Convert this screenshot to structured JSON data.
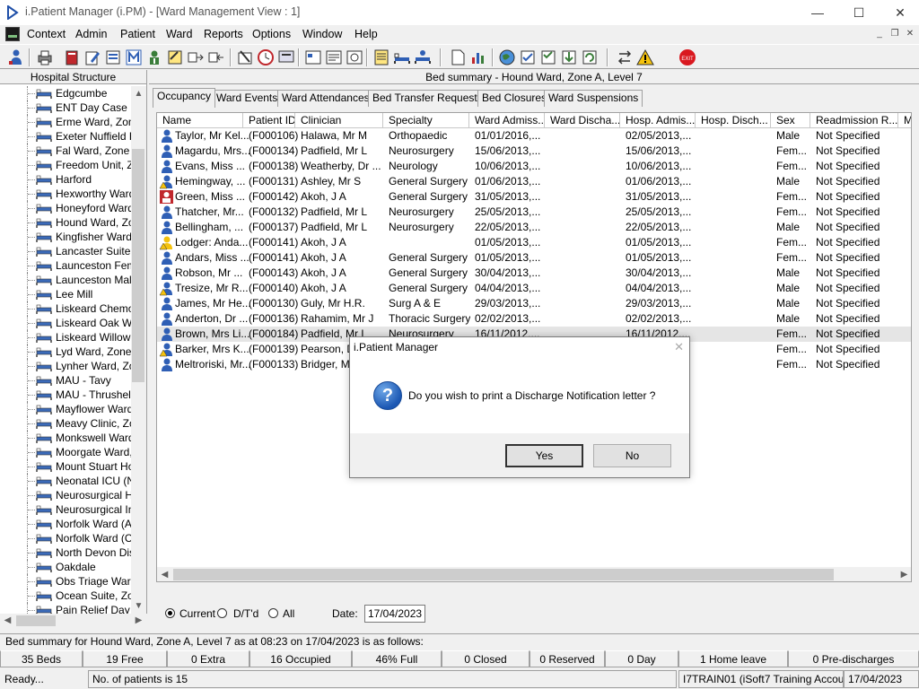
{
  "window": {
    "title": "i.Patient Manager (i.PM) - [Ward Management View : 1]",
    "minimize": "—",
    "maximize": "☐",
    "close": "✕"
  },
  "menu": {
    "items": [
      "Context",
      "Admin",
      "Patient",
      "Ward",
      "Reports",
      "Options",
      "Window",
      "Help"
    ],
    "mdi_min": "_",
    "mdi_restore": "❐",
    "mdi_close": "✕"
  },
  "left_panel": {
    "header": "Hospital Structure",
    "items": [
      "Edgcumbe",
      "ENT Day Case U",
      "Erme Ward, Zone",
      "Exeter Nuffield He",
      "Fal Ward, Zone E",
      "Freedom Unit, Zo",
      "Harford",
      "Hexworthy Ward,",
      "Honeyford Ward,",
      "Hound Ward, Zor",
      "Kingfisher Ward",
      "Lancaster Suite, Z",
      "Launceston Fema",
      "Launceston Male",
      "Lee Mill",
      "Liskeard Chemo D",
      "Liskeard Oak Wa",
      "Liskeard Willow V",
      "Lyd Ward, Zone I",
      "Lynher Ward, Zor",
      "MAU - Tavy",
      "MAU - Thrushel",
      "Mayflower Ward,",
      "Meavy Clinic, Zor",
      "Monkswell Ward,",
      "Moorgate Ward, Z",
      "Mount Stuart Hos",
      "Neonatal ICU (NN",
      "Neurosurgical Hig",
      "Neurosurgical Inte",
      "Norfolk Ward (Ad",
      "Norfolk Ward (Co",
      "North Devon Dist",
      "Oakdale",
      "Obs Triage Ward",
      "Ocean Suite, Zor",
      "Pain Relief Day C"
    ]
  },
  "main": {
    "bed_summary": "Bed summary - Hound Ward, Zone A, Level 7",
    "tabs": [
      "Occupancy",
      "Ward Events",
      "Ward Attendances",
      "Bed Transfer Requests",
      "Bed Closures",
      "Ward Suspensions"
    ],
    "columns": [
      "Name",
      "Patient ID",
      "Clinician",
      "Specialty",
      "Ward Admiss...",
      "Ward Discha...",
      "Hosp. Admis...",
      "Hosp. Disch...",
      "Sex",
      "Readmission R...",
      "Me"
    ],
    "rows": [
      {
        "icon": "patient-blue",
        "name": "Taylor, Mr Kel...",
        "id": "(F000106)",
        "clinician": "Halawa, Mr M",
        "specialty": "Orthopaedic",
        "ward_adm": "01/01/2016,...",
        "hosp_adm": "02/05/2013,...",
        "sex": "Male",
        "readm": "Not Specified"
      },
      {
        "icon": "patient-blue",
        "name": "Magardu, Mrs...",
        "id": "(F000134)",
        "clinician": "Padfield, Mr L",
        "specialty": "Neurosurgery",
        "ward_adm": "15/06/2013,...",
        "hosp_adm": "15/06/2013,...",
        "sex": "Fem...",
        "readm": "Not Specified"
      },
      {
        "icon": "patient-blue",
        "name": "Evans, Miss ...",
        "id": "(F000138)",
        "clinician": "Weatherby, Dr ...",
        "specialty": "Neurology",
        "ward_adm": "10/06/2013,...",
        "hosp_adm": "10/06/2013,...",
        "sex": "Fem...",
        "readm": "Not Specified"
      },
      {
        "icon": "patient-warning",
        "name": "Hemingway, ...",
        "id": "(F000131)",
        "clinician": "Ashley, Mr S",
        "specialty": "General Surgery",
        "ward_adm": "01/06/2013,...",
        "hosp_adm": "01/06/2013,...",
        "sex": "Male",
        "readm": "Not Specified"
      },
      {
        "icon": "patient-red",
        "name": "Green, Miss ...",
        "id": "(F000142)",
        "clinician": "Akoh, J A",
        "specialty": "General Surgery",
        "ward_adm": "31/05/2013,...",
        "hosp_adm": "31/05/2013,...",
        "sex": "Fem...",
        "readm": "Not Specified"
      },
      {
        "icon": "patient-blue",
        "name": "Thatcher, Mr...",
        "id": "(F000132)",
        "clinician": "Padfield, Mr L",
        "specialty": "Neurosurgery",
        "ward_adm": "25/05/2013,...",
        "hosp_adm": "25/05/2013,...",
        "sex": "Fem...",
        "readm": "Not Specified"
      },
      {
        "icon": "patient-blue",
        "name": "Bellingham, ...",
        "id": "(F000137)",
        "clinician": "Padfield, Mr L",
        "specialty": "Neurosurgery",
        "ward_adm": "22/05/2013,...",
        "hosp_adm": "22/05/2013,...",
        "sex": "Male",
        "readm": "Not Specified"
      },
      {
        "icon": "patient-yellow",
        "name": "Lodger: Anda...",
        "id": "(F000141)",
        "clinician": "Akoh, J A",
        "specialty": "",
        "ward_adm": "01/05/2013,...",
        "hosp_adm": "01/05/2013,...",
        "sex": "Fem...",
        "readm": "Not Specified"
      },
      {
        "icon": "patient-blue",
        "name": "Andars, Miss ...",
        "id": "(F000141)",
        "clinician": "Akoh, J A",
        "specialty": "General Surgery",
        "ward_adm": "01/05/2013,...",
        "hosp_adm": "01/05/2013,...",
        "sex": "Fem...",
        "readm": "Not Specified"
      },
      {
        "icon": "patient-blue",
        "name": "Robson, Mr ...",
        "id": "(F000143)",
        "clinician": "Akoh, J A",
        "specialty": "General Surgery",
        "ward_adm": "30/04/2013,...",
        "hosp_adm": "30/04/2013,...",
        "sex": "Male",
        "readm": "Not Specified"
      },
      {
        "icon": "patient-warning",
        "name": "Tresize, Mr R...",
        "id": "(F000140)",
        "clinician": "Akoh, J A",
        "specialty": "General Surgery",
        "ward_adm": "04/04/2013,...",
        "hosp_adm": "04/04/2013,...",
        "sex": "Male",
        "readm": "Not Specified"
      },
      {
        "icon": "patient-blue",
        "name": "James, Mr He...",
        "id": "(F000130)",
        "clinician": "Guly, Mr H.R.",
        "specialty": "Surg A & E",
        "ward_adm": "29/03/2013,...",
        "hosp_adm": "29/03/2013,...",
        "sex": "Male",
        "readm": "Not Specified"
      },
      {
        "icon": "patient-blue",
        "name": "Anderton, Dr ...",
        "id": "(F000136)",
        "clinician": "Rahamim, Mr J",
        "specialty": "Thoracic Surgery",
        "ward_adm": "02/02/2013,...",
        "hosp_adm": "02/02/2013,...",
        "sex": "Male",
        "readm": "Not Specified"
      },
      {
        "icon": "patient-blue",
        "name": "Brown, Mrs Li...",
        "id": "(F000184)",
        "clinician": "Padfield, Mr L",
        "specialty": "Neurosurgery",
        "ward_adm": "16/11/2012,...",
        "hosp_adm": "16/11/2012,...",
        "sex": "Fem...",
        "readm": "Not Specified"
      },
      {
        "icon": "patient-warning",
        "name": "Barker, Mrs K...",
        "id": "(F000139)",
        "clinician": "Pearson, D",
        "specialty": "",
        "ward_adm": "",
        "hosp_adm": "",
        "sex": "Fem...",
        "readm": "Not Specified"
      },
      {
        "icon": "patient-blue",
        "name": "Meltroriski, Mr...",
        "id": "(F000133)",
        "clinician": "Bridger, Mr",
        "specialty": "",
        "ward_adm": "",
        "hosp_adm": "",
        "sex": "Fem...",
        "readm": "Not Specified"
      }
    ],
    "filter": {
      "options": [
        "Current",
        "D/T'd",
        "All"
      ],
      "selected": "Current",
      "date_label": "Date:",
      "date_value": "17/04/2023"
    }
  },
  "summary_text": "Bed summary for Hound Ward, Zone A, Level 7 as at 08:23 on 17/04/2023 is as follows:",
  "stats": [
    "35 Beds",
    "19 Free",
    "0 Extra",
    "16 Occupied",
    "46% Full",
    "0 Closed",
    "0 Reserved",
    "0 Day",
    "1 Home leave",
    "0 Pre-discharges"
  ],
  "status": {
    "ready": "Ready...",
    "patients": "No. of patients is 15",
    "user": "I7TRAIN01 (iSoft7 Training Account)",
    "date": "17/04/2023"
  },
  "dialog": {
    "title": "i.Patient Manager",
    "close": "✕",
    "icon_glyph": "?",
    "message": "Do you wish to print a Discharge Notification letter ?",
    "yes": "Yes",
    "no": "No"
  },
  "colors": {
    "patient_blue": "#2f5fb5",
    "patient_red": "#c0282d",
    "warning_yellow": "#f4c20d",
    "exit_red": "#d9181f"
  }
}
